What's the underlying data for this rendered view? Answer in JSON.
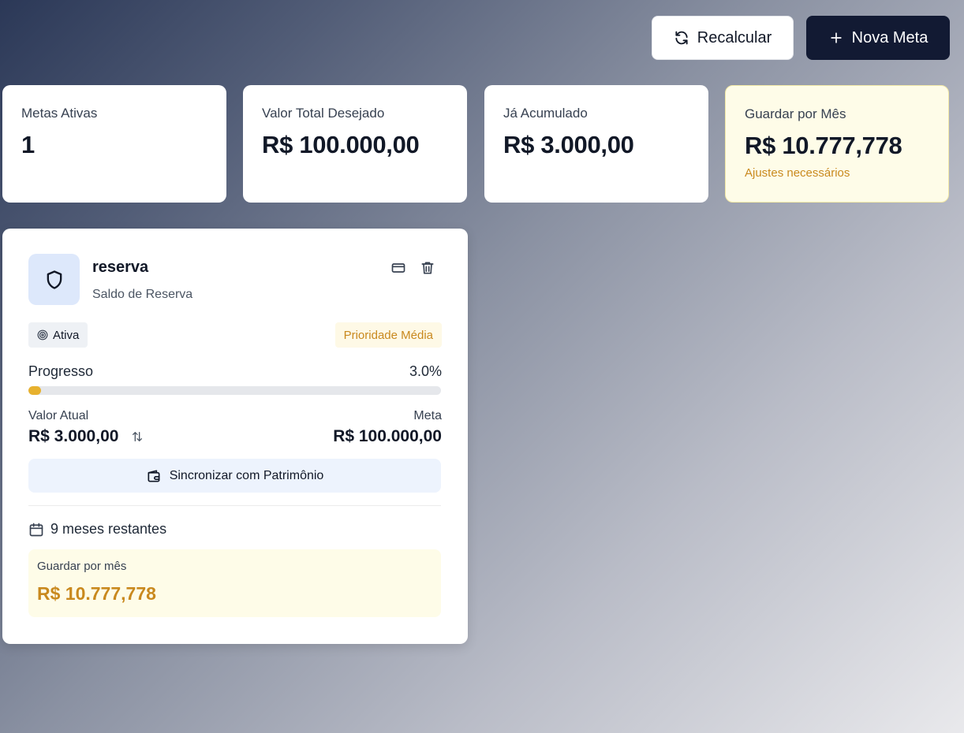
{
  "toolbar": {
    "recalc_label": "Recalcular",
    "new_goal_label": "Nova Meta"
  },
  "stats": {
    "active_goals": {
      "label": "Metas Ativas",
      "value": "1"
    },
    "total_desired": {
      "label": "Valor Total Desejado",
      "value": "R$ 100.000,00"
    },
    "accumulated": {
      "label": "Já Acumulado",
      "value": "R$ 3.000,00"
    },
    "monthly_save": {
      "label": "Guardar por Mês",
      "value": "R$ 10.777,778",
      "note": "Ajustes necessários"
    }
  },
  "goal": {
    "name": "reserva",
    "type": "Saldo de Reserva",
    "status": "Ativa",
    "priority": "Prioridade Média",
    "progress_label": "Progresso",
    "progress_text": "3.0%",
    "progress_fraction": 0.03,
    "current_label": "Valor Atual",
    "current_value": "R$ 3.000,00",
    "target_label": "Meta",
    "target_value": "R$ 100.000,00",
    "sync_label": "Sincronizar com Patrimônio",
    "remaining": "9 meses restantes",
    "monthly_label": "Guardar por mês",
    "monthly_value": "R$ 10.777,778"
  },
  "colors": {
    "accent_dark": "#121a33",
    "progress": "#e7b12e",
    "warning_text": "#c9891e",
    "warning_bg": "#fefce8"
  },
  "icons": {
    "recalc": "refresh-icon",
    "new_goal": "plus-icon",
    "goal": "shield-icon",
    "card_action": "credit-card-icon",
    "delete": "trash-icon",
    "status": "target-icon",
    "adjust": "arrows-up-down-icon",
    "sync": "wallet-icon",
    "remaining": "calendar-icon"
  }
}
